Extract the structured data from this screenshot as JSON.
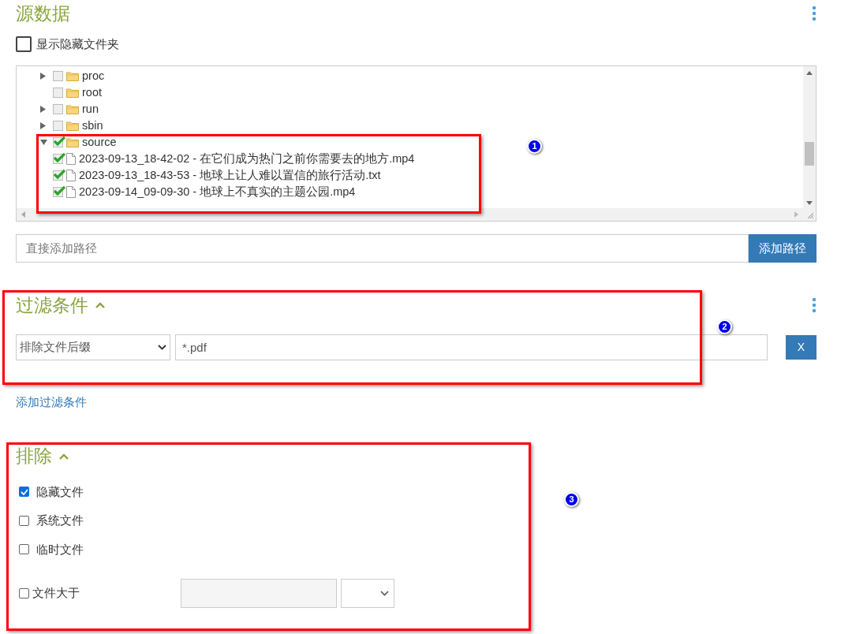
{
  "source_section": {
    "title": "源数据",
    "show_hidden": {
      "label": "显示隐藏文件夹",
      "checked": false
    },
    "tree": [
      {
        "kind": "folder",
        "label": "proc",
        "expanded": false,
        "checked": false
      },
      {
        "kind": "folder",
        "label": "root",
        "checked": false
      },
      {
        "kind": "folder",
        "label": "run",
        "expanded": false,
        "checked": false
      },
      {
        "kind": "folder",
        "label": "sbin",
        "expanded": false,
        "checked": false
      },
      {
        "kind": "folder",
        "label": "source",
        "expanded": true,
        "checked": true,
        "children": [
          {
            "kind": "file",
            "label": "2023-09-13_18-42-02 - 在它们成为热门之前你需要去的地方.mp4",
            "checked": true
          },
          {
            "kind": "file",
            "label": "2023-09-13_18-43-53 - 地球上让人难以置信的旅行活动.txt",
            "checked": true
          },
          {
            "kind": "file",
            "label": "2023-09-14_09-09-30 - 地球上不真实的主题公园.mp4",
            "checked": true
          }
        ]
      }
    ],
    "path_input": {
      "placeholder": "直接添加路径"
    },
    "add_path_button": "添加路径"
  },
  "filter_section": {
    "title": "过滤条件",
    "expanded": true,
    "rule": {
      "type": "排除文件后缀",
      "value": "*.pdf",
      "remove_button": "X"
    },
    "add_link": "添加过滤条件"
  },
  "exclude_section": {
    "title": "排除",
    "expanded": true,
    "options": [
      {
        "label": "隐藏文件",
        "checked": true
      },
      {
        "label": "系统文件",
        "checked": false
      },
      {
        "label": "临时文件",
        "checked": false
      }
    ],
    "size_option": {
      "label": "文件大于",
      "checked": false
    }
  },
  "annotations": [
    "1",
    "2",
    "3"
  ]
}
